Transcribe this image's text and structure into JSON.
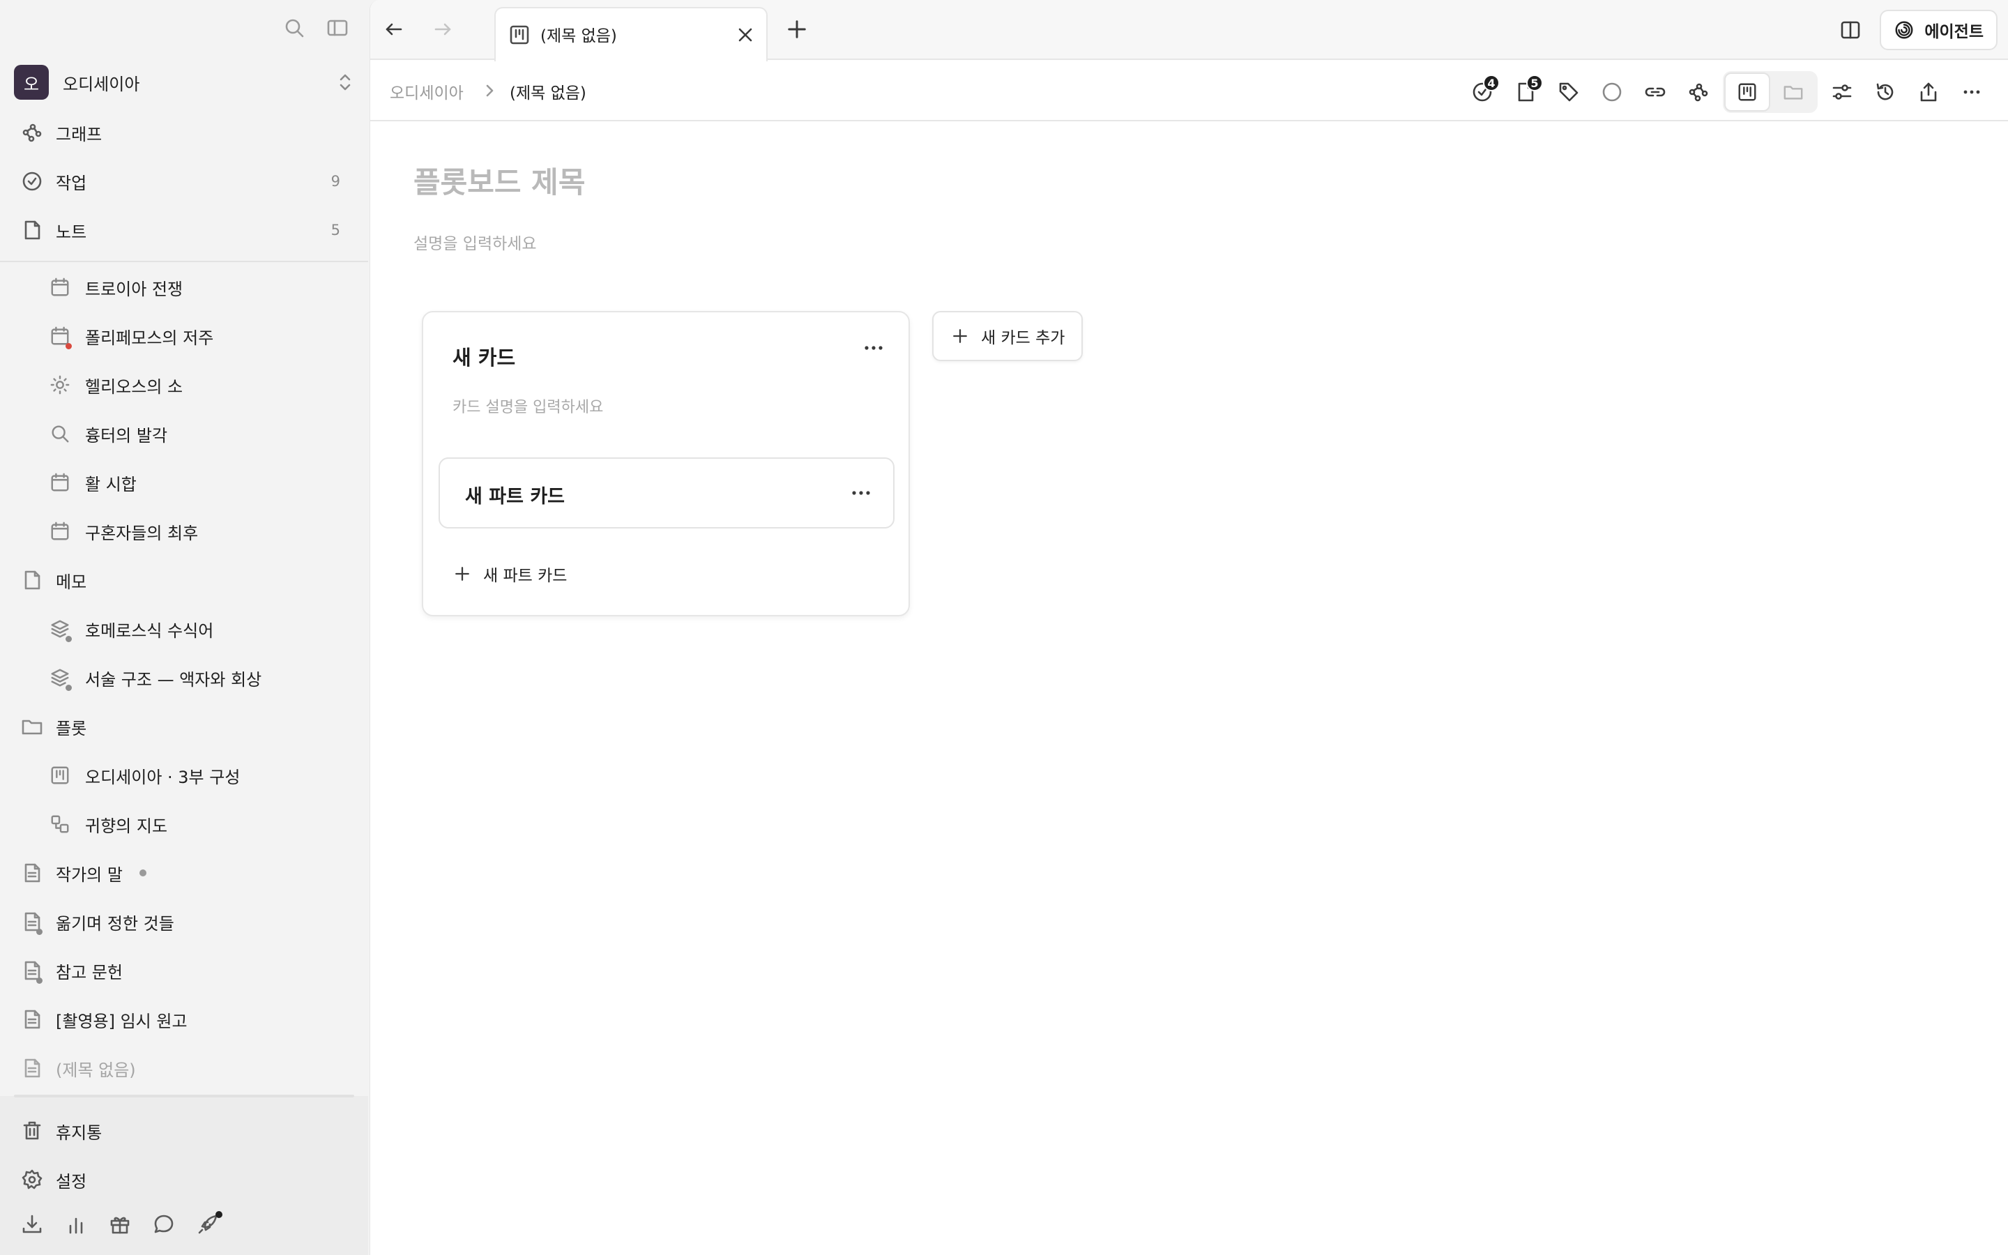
{
  "workspace": {
    "initial": "오",
    "name": "오디세이아"
  },
  "sidebar": {
    "graph": {
      "label": "그래프"
    },
    "tasks": {
      "label": "작업",
      "count": "9"
    },
    "notes": {
      "label": "노트",
      "count": "5"
    },
    "note_items": [
      {
        "label": "트로이아 전쟁",
        "icon": "calendar-icon"
      },
      {
        "label": "폴리페모스의 저주",
        "icon": "calendar-icon"
      },
      {
        "label": "헬리오스의 소",
        "icon": "sun-icon"
      },
      {
        "label": "흉터의 발각",
        "icon": "search-icon"
      },
      {
        "label": "활 시합",
        "icon": "calendar-icon"
      },
      {
        "label": "구혼자들의 최후",
        "icon": "calendar-icon"
      }
    ],
    "memo": {
      "label": "메모"
    },
    "memo_items": [
      {
        "label": "호메로스식 수식어",
        "icon": "layers-icon"
      },
      {
        "label": "서술 구조 — 액자와 회상",
        "icon": "layers-icon"
      }
    ],
    "plot": {
      "label": "플롯"
    },
    "plot_items": [
      {
        "label": "오디세이아 · 3부 구성",
        "icon": "board-icon"
      },
      {
        "label": "귀향의 지도",
        "icon": "map-icon"
      }
    ],
    "docs": [
      {
        "label": "작가의 말",
        "icon": "document-icon"
      },
      {
        "label": "옮기며 정한 것들",
        "icon": "document-icon"
      },
      {
        "label": "참고 문헌",
        "icon": "document-icon"
      },
      {
        "label": "[촬영용] 임시 원고",
        "icon": "document-icon"
      },
      {
        "label": "(제목 없음)",
        "icon": "document-icon"
      }
    ],
    "trash": {
      "label": "휴지통"
    },
    "settings": {
      "label": "설정"
    }
  },
  "tabbar": {
    "tab_title": "(제목 없음)",
    "agent_label": "에이전트"
  },
  "breadcrumb": {
    "root": "오디세이아",
    "current": "(제목 없음)"
  },
  "toolbar": {
    "tasks_badge": "4",
    "notes_badge": "5"
  },
  "board": {
    "title_placeholder": "플롯보드 제목",
    "desc_placeholder": "설명을 입력하세요",
    "add_card_label": "새 카드 추가",
    "cards": [
      {
        "title": "새 카드",
        "desc_placeholder": "카드 설명을 입력하세요",
        "parts": [
          {
            "title": "새 파트 카드"
          }
        ],
        "add_part_label": "새 파트 카드"
      }
    ]
  }
}
